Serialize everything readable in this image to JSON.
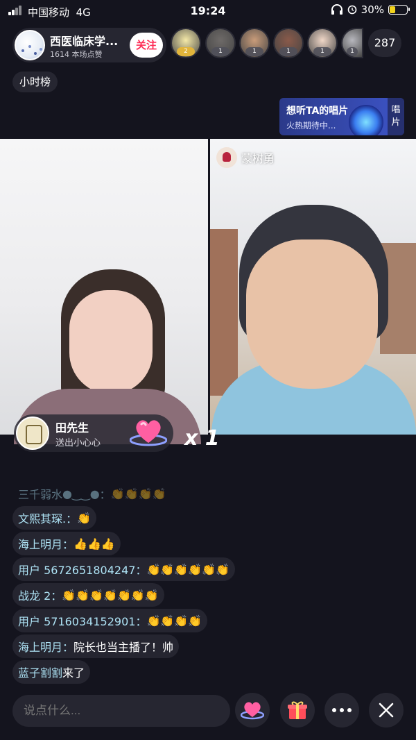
{
  "status_bar": {
    "carrier": "中国移动",
    "network": "4G",
    "time": "19:24",
    "battery": "30%",
    "battery_level": 0.3
  },
  "host": {
    "name": "西医临床学...",
    "likes": "1614 本场点赞",
    "follow_label": "关注"
  },
  "viewers": [
    {
      "rank": "2",
      "color": "#f5e9a8"
    },
    {
      "rank": "1",
      "color": "#6e6a68"
    },
    {
      "rank": "1",
      "color": "#c99c7a"
    },
    {
      "rank": "1",
      "color": "#8a5a4a"
    },
    {
      "rank": "1",
      "color": "#f0d7c7"
    },
    {
      "rank": "1",
      "color": "#b7b7bd"
    }
  ],
  "viewer_count": "287",
  "hour_rank_label": "小时榜",
  "promo": {
    "title": "想听TA的唱片",
    "subtitle": "火热期待中...",
    "tag": "唱片"
  },
  "cohost": {
    "name": "蒙树勇"
  },
  "gift": {
    "user": "田先生",
    "action": "送出小心心",
    "count": "x 1"
  },
  "chat": [
    {
      "user": "三千弱水",
      "mid": "●‿‿●",
      "sep": "：",
      "msg": "👏👏👏👏",
      "faded": true
    },
    {
      "user": "文熙其琛.",
      "sep": "：",
      "msg": "👏"
    },
    {
      "user": "海上明月",
      "sep": "：",
      "msg": "👍👍👍"
    },
    {
      "user": "用户 5672651804247",
      "sep": "：",
      "msg": "👏👏👏👏👏👏"
    },
    {
      "user": "战龙 2",
      "sep": "：",
      "msg": "👏👏👏👏👏👏👏"
    },
    {
      "user": "用户 5716034152901",
      "sep": "：",
      "msg": "👏👏👏👏"
    },
    {
      "user": "海上明月",
      "sep": "：",
      "msg": "院长也当主播了！帅"
    },
    {
      "user": "蓝子割割",
      "sep": " ",
      "msg": "来了"
    }
  ],
  "comment_placeholder": "说点什么...",
  "icons": {
    "heart": "heart-gift-icon",
    "gift": "gift-box-icon",
    "more": "more-dots-icon",
    "close": "close-icon"
  }
}
